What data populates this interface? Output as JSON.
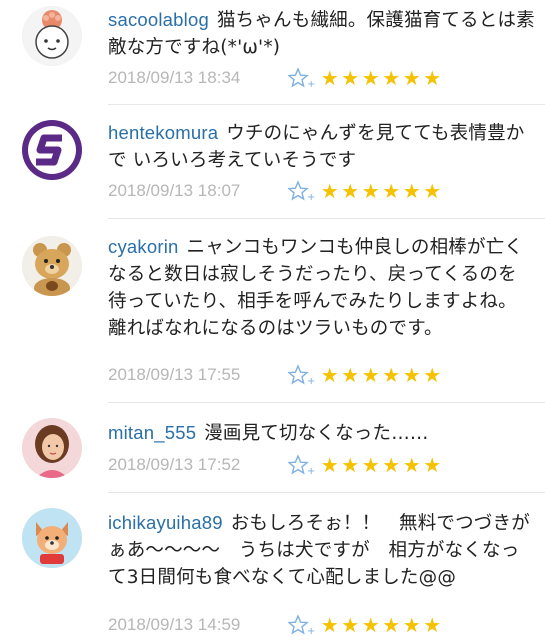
{
  "comments": [
    {
      "username": "sacoolablog",
      "text": "猫ちゃんも繊細。保護猫育てるとは素敵な方ですね(*'ω'*)",
      "timestamp": "2018/09/13 18:34",
      "stars": 6,
      "avatar_icon": "girl-face-avatar"
    },
    {
      "username": "hentekomura",
      "text": "ウチのにゃんずを見てても表情豊かで いろいろ考えていそうです",
      "timestamp": "2018/09/13 18:07",
      "stars": 6,
      "avatar_icon": "purple-s-logo-avatar"
    },
    {
      "username": "cyakorin",
      "text": "ニャンコもワンコも仲良しの相棒が亡くなると数日は寂しそうだったり、戻ってくるのを待っていたり、相手を呼んでみたりしますよね。離ればなれになるのはツラいものです。",
      "timestamp": "2018/09/13 17:55",
      "stars": 6,
      "avatar_icon": "teddy-bear-avatar"
    },
    {
      "username": "mitan_555",
      "text": "漫画見て切なくなった……",
      "timestamp": "2018/09/13 17:52",
      "stars": 6,
      "avatar_icon": "woman-photo-avatar"
    },
    {
      "username": "ichikayuiha89",
      "text": "おもしろそぉ！！　無料でつづきがぁあ〜〜〜〜　うちは犬ですが　相方がなくなって3日間何も食べなくて心配しました@@",
      "timestamp": "2018/09/13 14:59",
      "stars": 6,
      "avatar_icon": "dog-character-avatar"
    }
  ],
  "colors": {
    "username": "#2a6fa8",
    "timestamp": "#b7b7b7",
    "star": "#f4c200",
    "add_star_icon": "#7fb0e0"
  }
}
